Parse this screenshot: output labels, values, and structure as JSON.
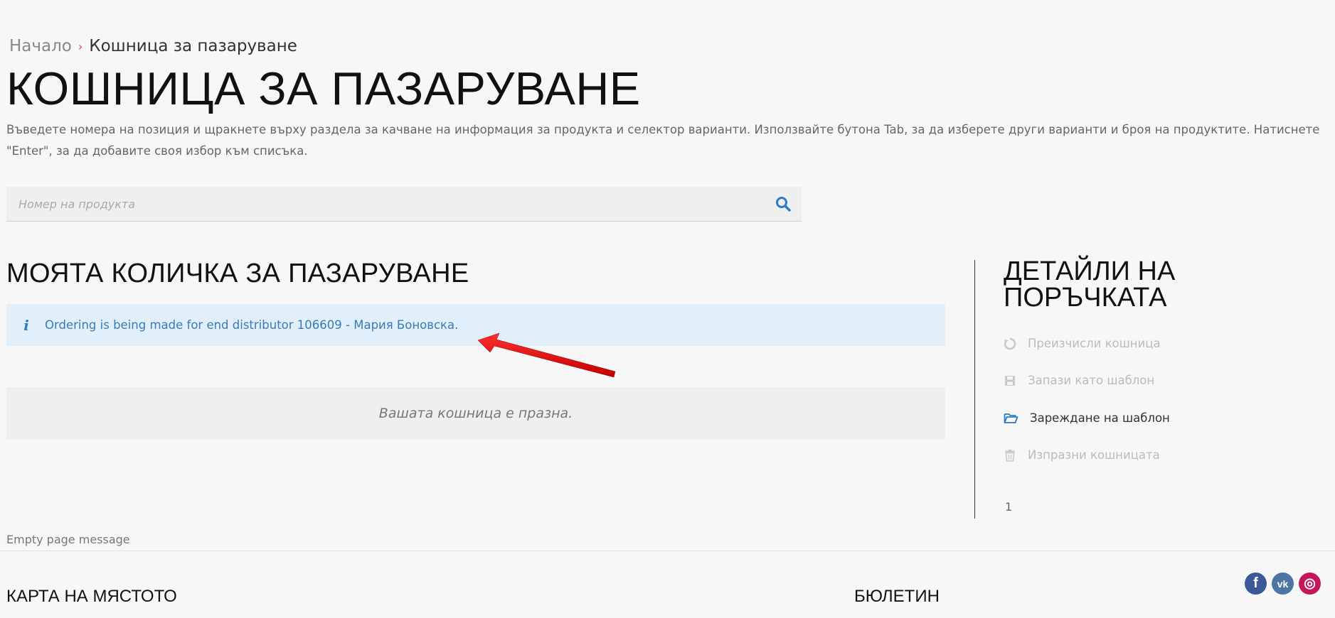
{
  "breadcrumb": {
    "home": "Начало",
    "separator": "›",
    "current": "Кошница за пазаруване"
  },
  "page_title": "КОШНИЦА ЗА ПАЗАРУВАНЕ",
  "intro_text": "Въведете номера на позиция и щракнете върху раздела за качване на информация за продукта и селектор варианти. Използвайте бутона Tab, за да изберете други варианти и броя на продуктите. Натиснете \"Enter\", за да добавите своя избор към списъка.",
  "search": {
    "placeholder": "Номер на продукта",
    "icon": "search-icon",
    "icon_color": "#2d7bc6"
  },
  "cart": {
    "title": "МОЯТА КОЛИЧКА ЗА ПАЗАРУВАНЕ",
    "alert_message": "Ordering is being made for end distributor 106609 - Мария Боновска.",
    "alert_bg": "#e1effa",
    "empty_text": "Вашата кошница е празна."
  },
  "order_details": {
    "title": "ДЕТАЙЛИ НА ПОРЪЧКАТА",
    "actions": [
      {
        "label": "Преизчисли кошница",
        "icon": "refresh-icon",
        "enabled": false
      },
      {
        "label": "Запази като шаблон",
        "icon": "save-icon",
        "enabled": false
      },
      {
        "label": "Зареждане на шаблон",
        "icon": "folder-open-icon",
        "enabled": true
      },
      {
        "label": "Изпразни кошницата",
        "icon": "trash-icon",
        "enabled": false
      }
    ],
    "page_number": "1"
  },
  "empty_page_message": "Empty page message",
  "footer": {
    "sitemap_title": "КАРТА НА МЯСТОТО",
    "newsletter_title": "БЮЛЕТИН",
    "social": [
      {
        "name": "facebook",
        "glyph": "f",
        "color": "#3b5998"
      },
      {
        "name": "vk",
        "glyph": "vk",
        "color": "#4c75a3"
      },
      {
        "name": "instagram",
        "glyph": "◎",
        "color": "#c2185b"
      }
    ]
  },
  "colors": {
    "background": "#f7f7f7",
    "accent": "#2d7bc6",
    "annotation_arrow": "#e01010"
  }
}
